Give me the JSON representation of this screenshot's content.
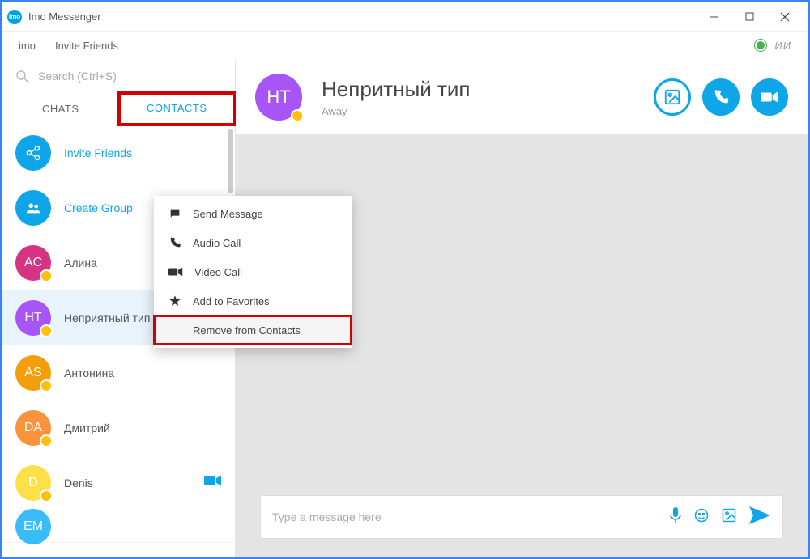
{
  "window": {
    "title": "Imo Messenger"
  },
  "menubar": {
    "imo": "imo",
    "invite": "Invite Friends",
    "user_initials": "ИИ"
  },
  "search": {
    "placeholder": "Search (Ctrl+S)"
  },
  "tabs": {
    "chats": "CHATS",
    "contacts": "CONTACTS"
  },
  "sidebar": {
    "invite": "Invite Friends",
    "create_group": "Create Group",
    "contacts": [
      {
        "initials": "AC",
        "name": "Алина",
        "color": "#d63384",
        "cam": true
      },
      {
        "initials": "HT",
        "name": "Неприятный тип",
        "color": "#a855f7",
        "cam": true
      },
      {
        "initials": "AS",
        "name": "Антонина",
        "color": "#f59e0b",
        "cam": false
      },
      {
        "initials": "DA",
        "name": "Дмитрий",
        "color": "#fb923c",
        "cam": false
      },
      {
        "initials": "D",
        "name": "Denis",
        "color": "#fde047",
        "cam": true
      },
      {
        "initials": "EM",
        "name": "",
        "color": "#38bdf8",
        "cam": false
      }
    ]
  },
  "chat_header": {
    "initials": "HT",
    "name": "Непритный тип",
    "status": "Away",
    "avatar_color": "#a855f7"
  },
  "context_menu": {
    "send_message": "Send Message",
    "audio_call": "Audio Call",
    "video_call": "Video Call",
    "add_favorites": "Add to Favorites",
    "remove": "Remove from Contacts"
  },
  "composer": {
    "placeholder": "Type a message here"
  }
}
